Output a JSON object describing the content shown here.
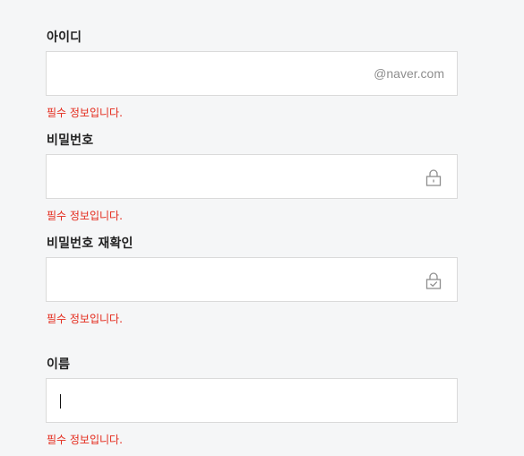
{
  "form": {
    "id": {
      "label": "아이디",
      "value": "",
      "suffix": "@naver.com",
      "error": "필수 정보입니다."
    },
    "password": {
      "label": "비밀번호",
      "value": "",
      "icon": "lock-icon",
      "error": "필수 정보입니다."
    },
    "password_confirm": {
      "label": "비밀번호 재확인",
      "value": "",
      "icon": "lock-check-icon",
      "error": "필수 정보입니다."
    },
    "name": {
      "label": "이름",
      "value": "",
      "error": "필수 정보입니다."
    }
  },
  "colors": {
    "background": "#f5f6f7",
    "error": "#e4291b",
    "border": "#dadada",
    "icon": "#8e8e8e"
  }
}
